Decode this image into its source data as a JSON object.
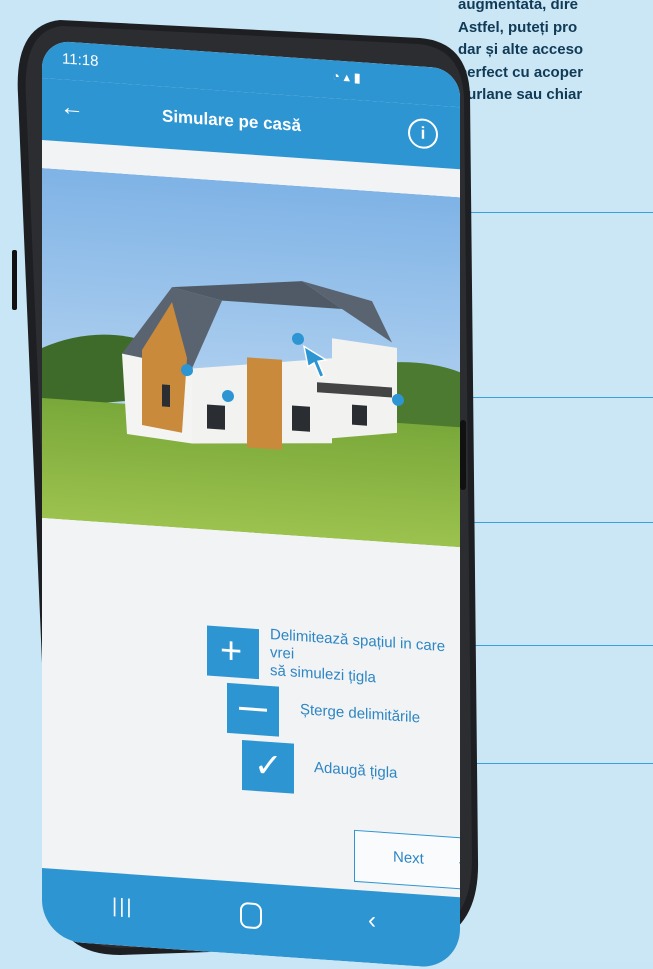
{
  "article": {
    "lines": [
      "augmentată, dire",
      "Astfel, puteți pro",
      "dar și alte acceso",
      "perfect cu acoper",
      "burlane sau chiar"
    ]
  },
  "status": {
    "time": "11:18"
  },
  "appbar": {
    "title": "Simulare pe casă"
  },
  "commands": [
    {
      "label": "Delimitează spațiul in care vrei să simulezi țigla",
      "line1": "Delimitează spațiul in care vrei",
      "line2": "să simulezi țigla",
      "icon": "plus-icon"
    },
    {
      "label": "Șterge delimitările",
      "icon": "minus-icon"
    },
    {
      "label": "Adaugă țigla",
      "icon": "check-icon"
    }
  ],
  "next": {
    "label": "Next"
  },
  "colors": {
    "accent": "#2e95d3",
    "background": "#c8e6f5",
    "text_dark": "#103a55"
  }
}
